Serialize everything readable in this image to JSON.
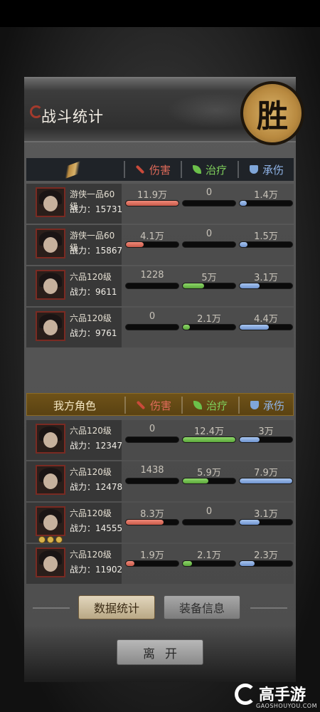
{
  "header": {
    "title": "战斗统计",
    "victory_char": "胜"
  },
  "columns": {
    "damage": "伤害",
    "heal": "治疗",
    "taken": "承伤",
    "ally_title": "我方角色"
  },
  "power_label": "战力：",
  "enemy_rows": [
    {
      "level": "游侠一品60级",
      "power": "15731",
      "damage": "11.9万",
      "heal": "0",
      "taken": "1.4万",
      "damage_pct": 1.0,
      "heal_pct": 0,
      "taken_pct": 0.14
    },
    {
      "level": "游侠一品60级",
      "power": "15867",
      "damage": "4.1万",
      "heal": "0",
      "taken": "1.5万",
      "damage_pct": 0.34,
      "heal_pct": 0,
      "taken_pct": 0.15
    },
    {
      "level": "六品120级",
      "power": "9611",
      "damage": "1228",
      "heal": "5万",
      "taken": "3.1万",
      "damage_pct": 0,
      "heal_pct": 0.4,
      "taken_pct": 0.38
    },
    {
      "level": "六品120级",
      "power": "9761",
      "damage": "0",
      "heal": "2.1万",
      "taken": "4.4万",
      "damage_pct": 0,
      "heal_pct": 0.14,
      "taken_pct": 0.55
    }
  ],
  "ally_rows": [
    {
      "level": "六品120级",
      "power": "12347",
      "damage": "0",
      "heal": "12.4万",
      "taken": "3万",
      "damage_pct": 0,
      "heal_pct": 1.0,
      "taken_pct": 0.38,
      "stars": 0
    },
    {
      "level": "六品120级",
      "power": "12478",
      "damage": "1438",
      "heal": "5.9万",
      "taken": "7.9万",
      "damage_pct": 0,
      "heal_pct": 0.48,
      "taken_pct": 1.0,
      "stars": 0
    },
    {
      "level": "六品120级",
      "power": "14555",
      "damage": "8.3万",
      "heal": "0",
      "taken": "3.1万",
      "damage_pct": 0.72,
      "heal_pct": 0,
      "taken_pct": 0.38,
      "stars": 3
    },
    {
      "level": "六品120级",
      "power": "11902",
      "damage": "1.9万",
      "heal": "2.1万",
      "taken": "2.3万",
      "damage_pct": 0.16,
      "heal_pct": 0.17,
      "taken_pct": 0.29,
      "stars": 0
    }
  ],
  "tabs": {
    "stats": "数据统计",
    "equipment": "装备信息"
  },
  "leave_label": "离开",
  "watermark": {
    "text": "高手游",
    "url": "GAOSHOUYOU.COM"
  },
  "colors": {
    "damage": "#e06b5a",
    "heal": "#7fcf5c",
    "taken": "#8fb3e6",
    "seal": "#c89a4e"
  }
}
